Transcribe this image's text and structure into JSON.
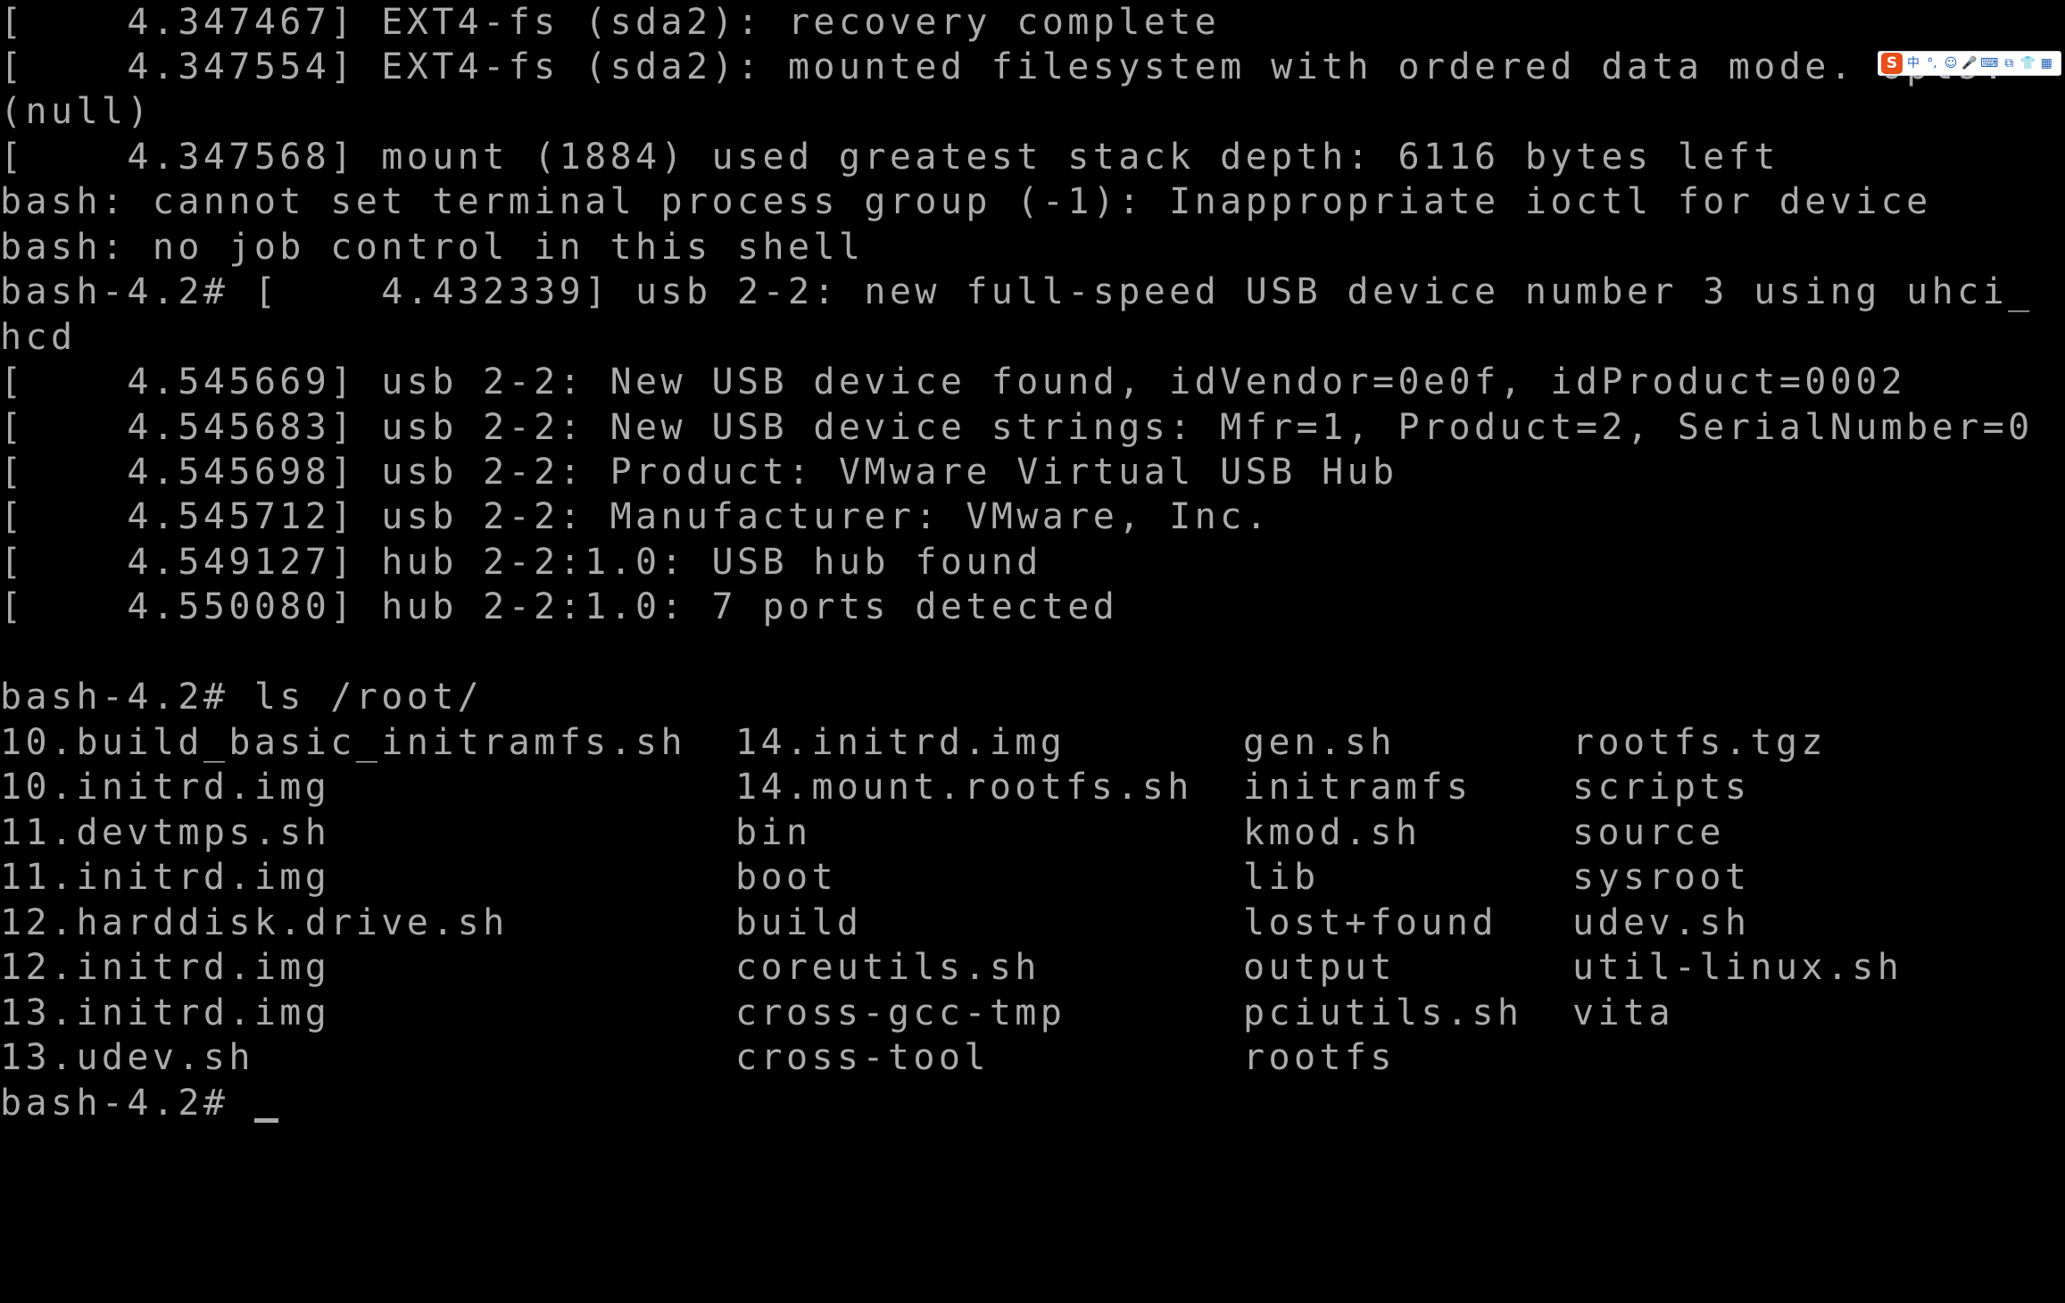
{
  "terminal": {
    "lines": [
      "[    4.347467] EXT4-fs (sda2): recovery complete",
      "[    4.347554] EXT4-fs (sda2): mounted filesystem with ordered data mode. Opts:",
      "(null)",
      "[    4.347568] mount (1884) used greatest stack depth: 6116 bytes left",
      "bash: cannot set terminal process group (-1): Inappropriate ioctl for device",
      "bash: no job control in this shell",
      "bash-4.2# [    4.432339] usb 2-2: new full-speed USB device number 3 using uhci_",
      "hcd",
      "[    4.545669] usb 2-2: New USB device found, idVendor=0e0f, idProduct=0002",
      "[    4.545683] usb 2-2: New USB device strings: Mfr=1, Product=2, SerialNumber=0",
      "[    4.545698] usb 2-2: Product: VMware Virtual USB Hub",
      "[    4.545712] usb 2-2: Manufacturer: VMware, Inc.",
      "[    4.549127] hub 2-2:1.0: USB hub found",
      "[    4.550080] hub 2-2:1.0: 7 ports detected",
      "",
      "bash-4.2# ls /root/"
    ],
    "ls_rows": [
      [
        "10.build_basic_initramfs.sh",
        "14.initrd.img",
        "gen.sh",
        "rootfs.tgz"
      ],
      [
        "10.initrd.img",
        "14.mount.rootfs.sh",
        "initramfs",
        "scripts"
      ],
      [
        "11.devtmps.sh",
        "bin",
        "kmod.sh",
        "source"
      ],
      [
        "11.initrd.img",
        "boot",
        "lib",
        "sysroot"
      ],
      [
        "12.harddisk.drive.sh",
        "build",
        "lost+found",
        "udev.sh"
      ],
      [
        "12.initrd.img",
        "coreutils.sh",
        "output",
        "util-linux.sh"
      ],
      [
        "13.initrd.img",
        "cross-gcc-tmp",
        "pciutils.sh",
        "vita"
      ],
      [
        "13.udev.sh",
        "cross-tool",
        "rootfs",
        ""
      ]
    ],
    "prompt": "bash-4.2# ",
    "colors": {
      "background": "#000000",
      "foreground": "#aaaaaa"
    }
  },
  "ime_toolbar": {
    "logo": "S",
    "buttons": [
      {
        "label": "中",
        "icon": "chinese-mode-icon"
      },
      {
        "label": "°,",
        "icon": "punctuation-icon"
      },
      {
        "label": "☺",
        "icon": "emoji-icon"
      },
      {
        "label": "🎤",
        "icon": "voice-input-icon"
      },
      {
        "label": "⌨",
        "icon": "keyboard-icon"
      },
      {
        "label": "⧉",
        "icon": "skin-icon"
      },
      {
        "label": "👕",
        "icon": "shirt-icon"
      },
      {
        "label": "▦",
        "icon": "toolbox-icon"
      }
    ],
    "colors": {
      "logo": "#e8501c",
      "icons": "#1f5fb4"
    }
  }
}
